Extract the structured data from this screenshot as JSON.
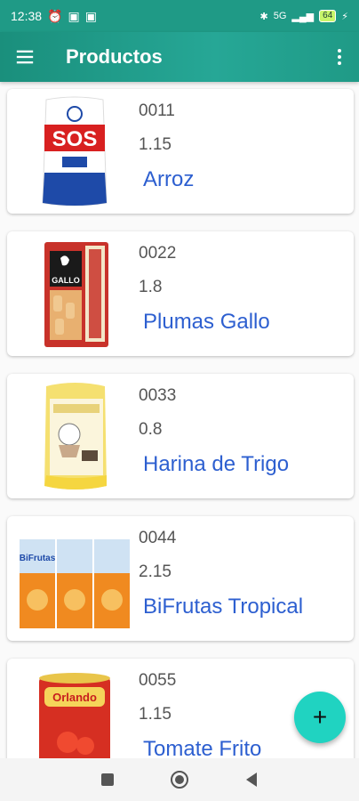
{
  "status": {
    "time": "12:38",
    "network": "5G",
    "battery": "64"
  },
  "appbar": {
    "title": "Productos"
  },
  "products": [
    {
      "code": "0011",
      "price": "1.15",
      "name": "Arroz",
      "image": "rice-package"
    },
    {
      "code": "0022",
      "price": "1.8",
      "name": "Plumas Gallo",
      "image": "pasta-package"
    },
    {
      "code": "0033",
      "price": "0.8",
      "name": "Harina de Trigo",
      "image": "flour-package"
    },
    {
      "code": "0044",
      "price": "2.15",
      "name": "BiFrutas Tropical",
      "image": "juice-cartons"
    },
    {
      "code": "0055",
      "price": "1.15",
      "name": "Tomate Frito",
      "image": "tomato-can"
    }
  ],
  "product_images": {
    "rice_brand": "SOS",
    "pasta_brand": "GALLO",
    "juice_brand": "BiFrutas",
    "tomato_brand": "Orlando"
  },
  "fab": {
    "label": "+"
  },
  "colors": {
    "primary": "#1f9a86",
    "accent": "#20d3c1",
    "name_text": "#2d5fd0"
  }
}
